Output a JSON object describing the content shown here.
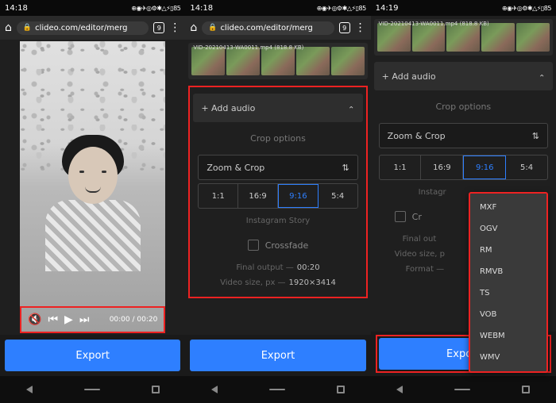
{
  "status": {
    "time1": "14:18",
    "time2": "14:18",
    "time3": "14:19",
    "icons": "⊕◉✈◎⚙✱△⚡▯85"
  },
  "url": "clideo.com/editor/merg",
  "tabs": "9",
  "thumb_label": "VID-20210413-WA0011.mp4 (818.8 KB)",
  "controls": {
    "cur": "00:00",
    "dur": "00:20"
  },
  "add_audio": "Add audio",
  "crop_title": "Crop options",
  "zoom_crop": "Zoom & Crop",
  "ratios": [
    "1:1",
    "16:9",
    "9:16",
    "5:4"
  ],
  "story": "Instagram Story",
  "instagram": "Instagr",
  "crossfade": "Crossfade",
  "cr_short": "Cr",
  "final_label": "Final output —",
  "final_val": "00:20",
  "final_short": "Final out",
  "size_label": "Video size, px —",
  "size_val": "1920×3414",
  "size_short": "Video size, p",
  "format_short": "Format —",
  "formats": [
    "MXF",
    "OGV",
    "RM",
    "RMVB",
    "TS",
    "VOB",
    "WEBM",
    "WMV"
  ],
  "export": "Export"
}
